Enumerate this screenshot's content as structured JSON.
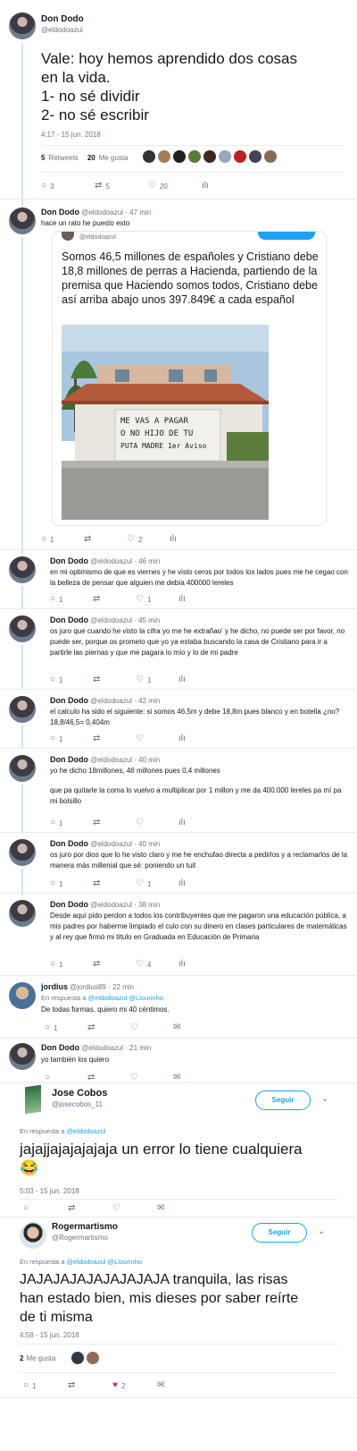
{
  "main_tweet": {
    "name": "Don Dodo",
    "handle": "@eldodoazul",
    "text_lines": [
      "Vale: hoy hemos aprendido dos cosas",
      "en la vida.",
      "1- no sé dividir",
      "2- no sé escribir"
    ],
    "timestamp": "4:17 - 15 jun. 2018",
    "retweets_count": "5",
    "retweets_label": "Retweets",
    "likes_count": "20",
    "likes_label": "Me gusta",
    "actions": {
      "reply": "3",
      "retweet": "5",
      "like": "20"
    }
  },
  "thread": [
    {
      "name": "Don Dodo",
      "handle": "@eldodoazul",
      "time": "· 47 min",
      "text": "hace un rato he puesto esto",
      "quoted": {
        "handle": "@eldodoazul",
        "text": "Somos 46,5 millones de españoles y Cristiano debe 18,8 millones de perras a Hacienda, partiendo de la premisa que Haciendo somos todos, Cristiano debe así arriba abajo unos 397.849€ a cada español",
        "graffiti_lines": [
          "ME VAS A PAGAR",
          "O NO HIJO DE TU",
          "PUTA MADRE 1er Aviso"
        ]
      },
      "actions": {
        "reply": "1",
        "retweet": "",
        "like": "2"
      }
    },
    {
      "name": "Don Dodo",
      "handle": "@eldodoazul",
      "time": "· 46 min",
      "text": "en mi optimismo de que es viernes y he visto ceros por todos los lados pues me he cegao con la belleza de pensar que alguien me debía 400000 lereles",
      "actions": {
        "reply": "1",
        "retweet": "",
        "like": "1"
      }
    },
    {
      "name": "Don Dodo",
      "handle": "@eldodoazul",
      "time": "· 45 min",
      "text": "os juro que cuando he visto la cifra yo me he extrañao' y he dicho, no puede ser por favor, no puede ser, porque os prometo que yo ya estaba buscando la casa de Cristiano para ir a partirle las piernas y que me pagara lo mío y lo de mi padre",
      "actions": {
        "reply": "1",
        "retweet": "",
        "like": "1"
      }
    },
    {
      "name": "Don Dodo",
      "handle": "@eldodoazul",
      "time": "· 42 min",
      "text": "el calculo ha sido el siguiente: si somos 46,5m y debe 18,8m pues blanco y en botella ¿no?  18,8/46,5= 0,404m",
      "actions": {
        "reply": "1",
        "retweet": "",
        "like": ""
      }
    },
    {
      "name": "Don Dodo",
      "handle": "@eldodoazul",
      "time": "· 40 min",
      "text": "yo he dicho 18millones, 46 millones pues 0,4 millones",
      "text2": "que pa quitarle la coma lo vuelvo a multiplicar por 1 millon y me da 400.000 lereles pa mí pa mi bolsillo",
      "actions": {
        "reply": "1",
        "retweet": "",
        "like": ""
      }
    },
    {
      "name": "Don Dodo",
      "handle": "@eldodoazul",
      "time": "· 40 min",
      "text": "os juro por dios que lo he visto claro y me he enchufao directa a pedirlos y a reclamarlos de la manera más millenial que sé: poniendo un tuit",
      "actions": {
        "reply": "1",
        "retweet": "",
        "like": "1"
      }
    },
    {
      "name": "Don Dodo",
      "handle": "@eldodoazul",
      "time": "· 38 min",
      "text": "Desde aquí pido perdon a todos los contribuyentes que me pagaron una educación pública, a mis padres por haberme limpiado el culo con su dinero en clases particulares de matemáticas y al rey que firmó mi título en Graduada en Educación de Primaria",
      "actions": {
        "reply": "1",
        "retweet": "",
        "like": "4"
      }
    }
  ],
  "reply_jordius": {
    "name": "jordius",
    "handle": "@jordius89",
    "time": "· 22 min",
    "reply_prefix": "En respuesta a",
    "reply_to": "@eldodoazul @Llourinho",
    "text": "De todas formas, quiero mi 40 céntimos.",
    "actions": {
      "reply": "1",
      "retweet": "",
      "like": ""
    }
  },
  "reply_dodo": {
    "name": "Don Dodo",
    "handle": "@eldodoazul",
    "time": "· 21 min",
    "text": "yo también los quiero",
    "actions": {
      "reply": "",
      "retweet": "",
      "like": ""
    }
  },
  "jose": {
    "name": "Jose Cobos",
    "handle": "@josecobos_11",
    "follow_label": "Seguir",
    "reply_prefix": "En respuesta a",
    "reply_to": "@eldodoazul",
    "text": "jajajjajajajajaja un error lo tiene cualquiera",
    "emoji": "😂",
    "timestamp": "5:03 - 15 jun. 2018"
  },
  "roger": {
    "name": "Rogermartismo",
    "handle": "@Rogermartismo",
    "follow_label": "Seguir",
    "reply_prefix": "En respuesta a",
    "reply_to": "@eldodoazul @Llourinho",
    "text_lines": [
      "JAJAJAJAJAJAJAJAJA tranquila, las risas",
      "han estado bien, mis dieses por saber reírte",
      "de ti misma"
    ],
    "timestamp": "4:58 - 15 jun. 2018",
    "likes_count": "2",
    "likes_label": "Me gusta",
    "actions": {
      "reply": "1",
      "retweet": "",
      "like": "2"
    }
  },
  "colors": {
    "accent": "#1da1f2",
    "muted": "#657786",
    "like_red": "#e0245e",
    "thread": "#cfe6f7"
  }
}
